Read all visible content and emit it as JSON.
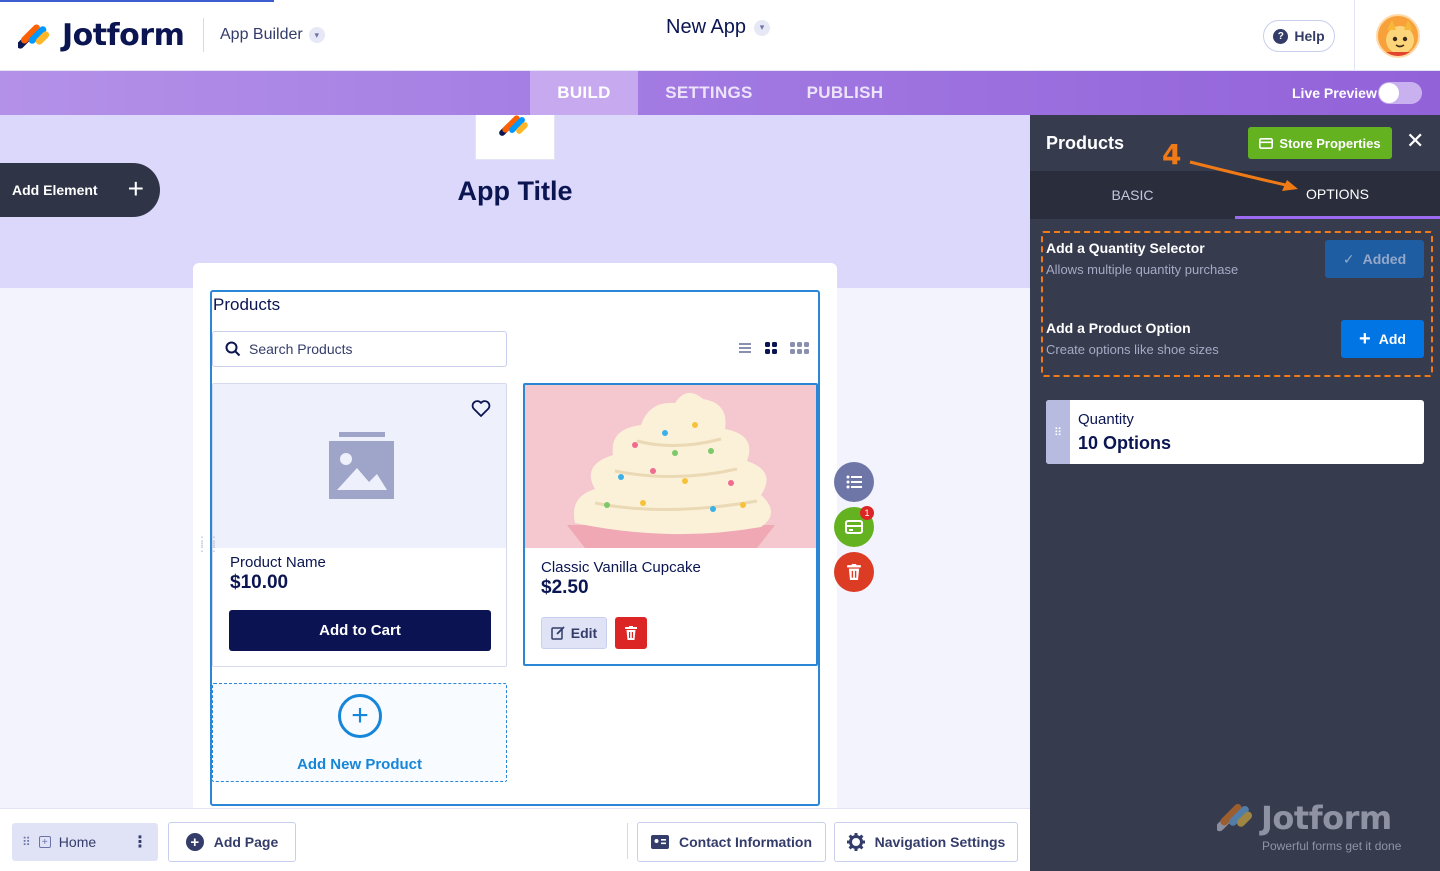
{
  "header": {
    "brand": "Jotform",
    "section": "App Builder",
    "app_name": "New App",
    "help_label": "Help"
  },
  "nav": {
    "tabs": [
      {
        "label": "BUILD",
        "active": true
      },
      {
        "label": "SETTINGS",
        "active": false
      },
      {
        "label": "PUBLISH",
        "active": false
      }
    ],
    "live_preview_label": "Live Preview",
    "live_preview_on": false
  },
  "canvas": {
    "add_element_label": "Add Element",
    "app_title": "App Title",
    "widget_title": "Products",
    "search_placeholder": "Search Products",
    "products": [
      {
        "name": "Product Name",
        "price": "$10.00",
        "button": "Add to Cart",
        "has_image": false
      },
      {
        "name": "Classic Vanilla Cupcake",
        "price": "$2.50",
        "edit_label": "Edit",
        "has_image": true
      }
    ],
    "add_new_label": "Add New Product",
    "tool_badge": "1"
  },
  "bottombar": {
    "page_label": "Home",
    "add_page_label": "Add Page",
    "contact_label": "Contact Information",
    "nav_settings_label": "Navigation Settings"
  },
  "panel": {
    "title": "Products",
    "store_properties_label": "Store Properties",
    "tabs": [
      {
        "label": "BASIC",
        "active": false
      },
      {
        "label": "OPTIONS",
        "active": true
      }
    ],
    "quantity_selector": {
      "title": "Add a Quantity Selector",
      "desc": "Allows multiple quantity purchase",
      "button": "Added"
    },
    "product_option": {
      "title": "Add a Product Option",
      "desc": "Create options like shoe sizes",
      "button": "Add"
    },
    "quantity_item": {
      "label": "Quantity",
      "value": "10 Options"
    },
    "watermark_brand": "Jotform",
    "watermark_tagline": "Powerful forms get it done"
  },
  "annotation": {
    "step": "4"
  },
  "colors": {
    "accent_purple": "#9c6bf2",
    "primary_blue": "#0075e3",
    "success_green": "#64b220",
    "danger_red": "#dc2626",
    "annotation_orange": "#f07a16",
    "navy": "#0a1551"
  }
}
